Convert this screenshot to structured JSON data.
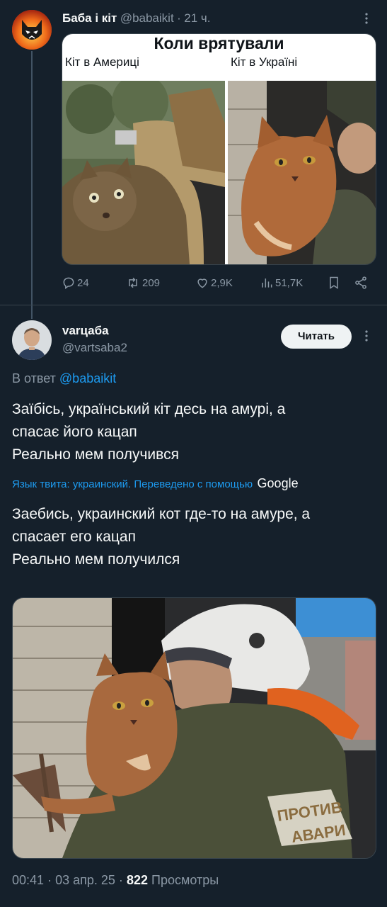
{
  "tweet1": {
    "author_name": "Баба і кіт",
    "author_handle": "@babaikit",
    "sep": "·",
    "time": "21 ч.",
    "meme": {
      "title": "Коли врятували",
      "left_caption": "Кіт в Америці",
      "right_caption": "Кіт в Україні"
    },
    "actions": {
      "replies": "24",
      "retweets": "209",
      "likes": "2,9K",
      "views": "51,7K"
    }
  },
  "tweet2": {
    "author_name": "varцаба",
    "author_handle": "@vartsaba2",
    "follow_label": "Читать",
    "reply_prefix": "В ответ",
    "reply_to": "@babaikit",
    "text": "Заїбісь, український кіт десь на амурі, а\nспасає його кацап\nРеально мем получився",
    "translation_note": "Язык твита: украинский. Переведено с помощью",
    "translation_brand": "Google",
    "translated_text": "Заебись, украинский кот где-то на амуре, а\nспасает его кацап\nРеально мем получился",
    "photo_badge_text": "ПРОТИВ\nАВАРИ",
    "time": "00:41",
    "date": "03 апр. 25",
    "views_count": "822",
    "views_label": "Просмотры"
  },
  "colors": {
    "background": "#15202b",
    "accent": "#1d9bf0",
    "muted": "#8b98a5",
    "divider": "#38444d"
  },
  "icons": [
    "reply-icon",
    "retweet-icon",
    "like-icon",
    "views-icon",
    "bookmark-icon",
    "share-icon",
    "more-icon"
  ]
}
